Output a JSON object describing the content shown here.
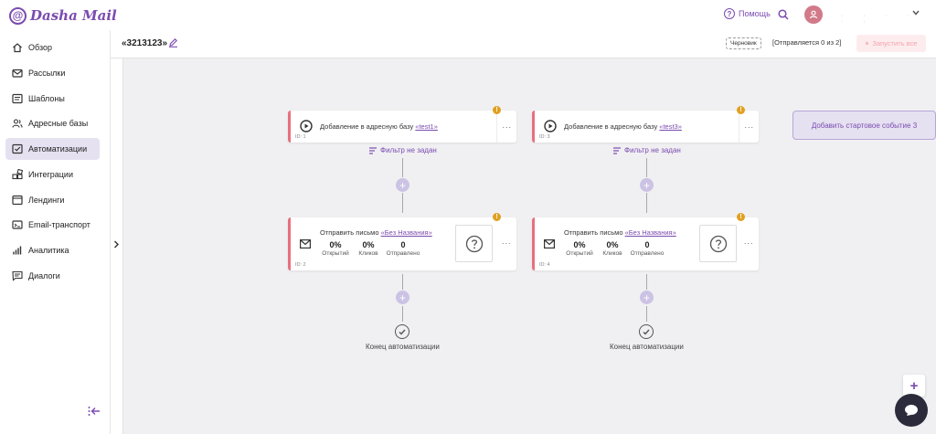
{
  "app": {
    "logo_at": "@",
    "logo_text": "Dasha Mail"
  },
  "topbar": {
    "help_label": "Помощь",
    "user_name_hidden": "· · · · · ·"
  },
  "sidebar": {
    "items": [
      {
        "label": "Обзор",
        "icon": "home-icon"
      },
      {
        "label": "Рассылки",
        "icon": "mail-icon"
      },
      {
        "label": "Шаблоны",
        "icon": "template-icon"
      },
      {
        "label": "Адресные базы",
        "icon": "users-icon"
      },
      {
        "label": "Автоматизации",
        "icon": "automation-icon",
        "active": true
      },
      {
        "label": "Интеграции",
        "icon": "integrations-icon"
      },
      {
        "label": "Лендинги",
        "icon": "landing-icon"
      },
      {
        "label": "Email-транспорт",
        "icon": "transport-icon"
      },
      {
        "label": "Аналитика",
        "icon": "analytics-icon"
      },
      {
        "label": "Диалоги",
        "icon": "dialogs-icon"
      }
    ]
  },
  "header": {
    "title": "«3213123»",
    "draft_badge": "Черновик",
    "sent_status": "[Отправляется 0 из 2]",
    "launch_all": "Запустить все"
  },
  "flows": [
    {
      "trigger": {
        "text": "Добавление в адресную базу ",
        "link": "«test1»",
        "id": "ID: 1"
      },
      "filter": "Фильтр не задан",
      "action": {
        "text": "Отправить письмо ",
        "link": "«Без Названия»",
        "id": "ID: 2",
        "stats": [
          {
            "value": "0%",
            "label": "Открытий"
          },
          {
            "value": "0%",
            "label": "Кликов"
          },
          {
            "value": "0",
            "label": "Отправлено"
          }
        ]
      },
      "end_label": "Конец автоматизации"
    },
    {
      "trigger": {
        "text": "Добавление в адресную базу ",
        "link": "«test3»",
        "id": "ID: 3"
      },
      "filter": "Фильтр не задан",
      "action": {
        "text": "Отправить письмо ",
        "link": "«Без Названия»",
        "id": "ID: 4",
        "stats": [
          {
            "value": "0%",
            "label": "Открытий"
          },
          {
            "value": "0%",
            "label": "Кликов"
          },
          {
            "value": "0",
            "label": "Отправлено"
          }
        ]
      },
      "end_label": "Конец автоматизации"
    }
  ],
  "start_event_button": "Добавить стартовое событие 3",
  "colors": {
    "brand": "#7b4bb0",
    "active_nav_bg": "#e6e1f1",
    "card_accent": "#e8707e",
    "warning": "#e0a020",
    "launch_bg": "#fdecee"
  }
}
